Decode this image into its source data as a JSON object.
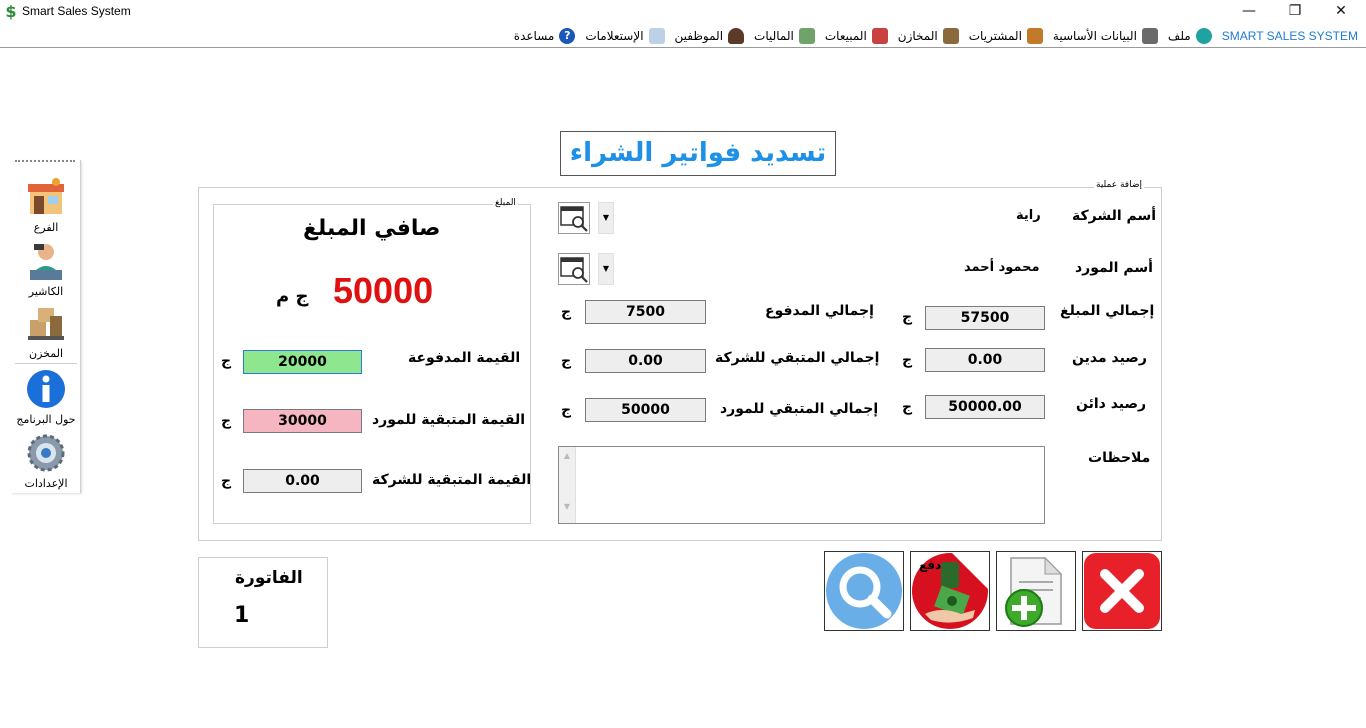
{
  "window": {
    "title": "Smart Sales System",
    "app_icon": "$",
    "minimize": "—",
    "restore": "❐",
    "close": "✕"
  },
  "menu": {
    "brand": "SMART SALES SYSTEM",
    "items": [
      {
        "label": "ملف",
        "icon": "file-icon"
      },
      {
        "label": "البيانات الأساسية",
        "icon": "basic-data-icon"
      },
      {
        "label": "المشتريات",
        "icon": "purchases-icon"
      },
      {
        "label": "المخازن",
        "icon": "warehouse-icon"
      },
      {
        "label": "المبيعات",
        "icon": "cart-icon"
      },
      {
        "label": "الماليات",
        "icon": "finance-icon"
      },
      {
        "label": "الموظفين",
        "icon": "employees-icon"
      },
      {
        "label": "الإستعلامات",
        "icon": "queries-icon"
      },
      {
        "label": "مساعدة",
        "icon": "help-icon"
      }
    ]
  },
  "toolbox": {
    "items": [
      {
        "label": "الفرع",
        "icon": "branch-icon"
      },
      {
        "label": "الكاشير",
        "icon": "cashier-icon"
      },
      {
        "label": "المخزن",
        "icon": "store-icon"
      },
      {
        "label": "حول البرنامج",
        "icon": "info-icon"
      },
      {
        "label": "الإعدادات",
        "icon": "settings-icon"
      }
    ]
  },
  "heading": "تسديد فواتير الشراء",
  "operation": {
    "caption": "إضافة عملية",
    "company_label": "أسم الشركة",
    "company_value": "راية",
    "supplier_label": "أسم المورد",
    "supplier_value": "محمود أحمد",
    "total_amount_label": "إجمالي المبلغ",
    "total_amount": "57500",
    "total_paid_label": "إجمالي المدفوع",
    "total_paid": "7500",
    "debit_balance_label": "رصيد مدين",
    "debit_balance": "0.00",
    "remaining_company_label": "إجمالي المتبقي للشركة",
    "remaining_company": "0.00",
    "credit_balance_label": "رصيد دائن",
    "credit_balance": "50000.00",
    "remaining_supplier_label": "إجمالي المتبقي للمورد",
    "remaining_supplier": "50000",
    "notes_label": "ملاحظات",
    "notes_value": "",
    "currency": "ج"
  },
  "amount": {
    "caption": "المبلغ",
    "net_label": "صافي المبلغ",
    "net_value": "50000",
    "net_currency": "ج م",
    "paid_label": "القيمة المدفوعة",
    "paid_value": "20000",
    "remaining_supplier_label": "القيمة المتبقية للمورد",
    "remaining_supplier_value": "30000",
    "remaining_company_label": "القيمة المتبقية للشركة",
    "remaining_company_value": "0.00",
    "currency": "ج"
  },
  "invoice": {
    "label": "الفاتورة",
    "number": "1"
  },
  "actions": {
    "pay_label": "دفع"
  },
  "colors": {
    "heading": "#1e90e6",
    "net_value": "#e01010",
    "paid_field": "#8ee68e",
    "remaining_field": "#f5b6c1",
    "close_button": "#e8202a",
    "search_button": "#6aaee8"
  }
}
